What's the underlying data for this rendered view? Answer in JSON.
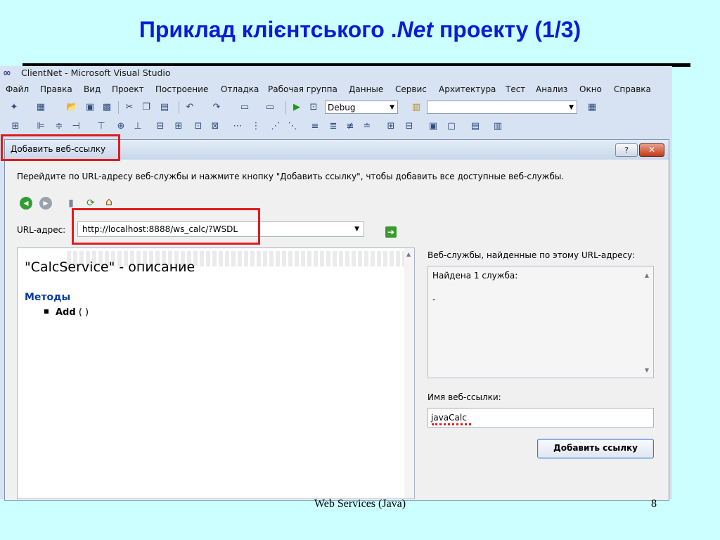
{
  "slide": {
    "title_pre": "Приклад клієнтського .",
    "title_italic": "Net",
    "title_post": " проекту   (1/3)",
    "footer": "Web Services (Java)",
    "page_number": "8"
  },
  "window": {
    "title": "ClientNet - Microsoft Visual Studio"
  },
  "menu": [
    "Файл",
    "Правка",
    "Вид",
    "Проект",
    "Построение",
    "Отладка",
    "Рабочая группа",
    "Данные",
    "Сервис",
    "Архитектура",
    "Тест",
    "Анализ",
    "Окно",
    "Справка"
  ],
  "toolbar": {
    "config_value": "Debug",
    "search_value": ""
  },
  "dialog": {
    "title": "Добавить веб-ссылку",
    "help_label": "?",
    "close_label": "✕",
    "instruction": "Перейдите по URL-адресу веб-службы и нажмите кнопку \"Добавить ссылку\", чтобы добавить все доступные веб-службы.",
    "url_label": "URL-адрес:",
    "url_value": "http://localhost:8888/ws_calc/?WSDL",
    "description_title": "\"CalcService\" - описание",
    "methods_heading": "Методы",
    "method_name": "Add",
    "method_args": " ( )",
    "found_label": "Веб-службы, найденные по этому URL-адресу:",
    "found_line1": "Найдена 1 служба:",
    "found_line2": "-",
    "name_label": "Имя веб-ссылки:",
    "name_value": "javaCalc",
    "add_button": "Добавить ссылку"
  },
  "colors": {
    "slide_bg": "#ccffff",
    "title_color": "#0a1cd6",
    "highlight_red": "#e01b1b"
  }
}
